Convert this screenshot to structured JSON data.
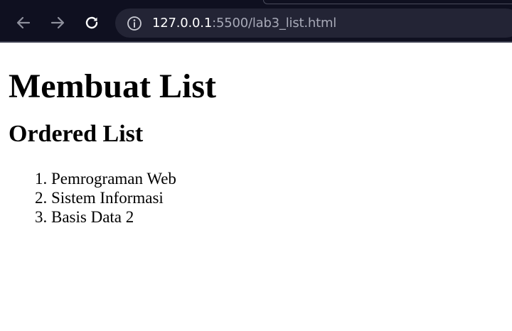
{
  "browser": {
    "url_host": "127.0.0.1",
    "url_rest": ":5500/lab3_list.html",
    "icons": {
      "back": "arrow-left-icon",
      "forward": "arrow-right-icon",
      "reload": "reload-icon",
      "site_info": "info-icon"
    }
  },
  "page": {
    "title": "Membuat List",
    "subtitle": "Ordered List",
    "ordered_list": [
      "Pemrograman Web",
      "Sistem Informasi",
      "Basis Data 2"
    ]
  }
}
